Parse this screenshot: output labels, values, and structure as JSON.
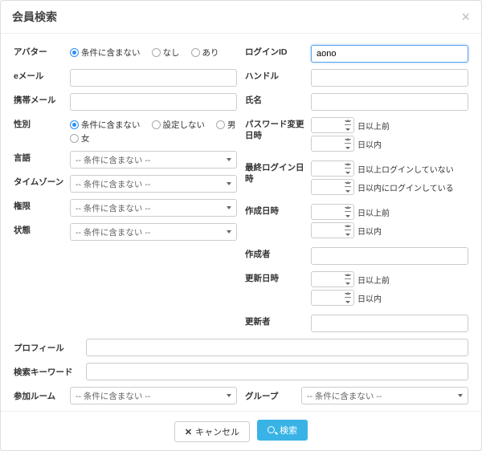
{
  "modal": {
    "title": "会員検索"
  },
  "left": {
    "avatar": {
      "label": "アバター",
      "opt1": "条件に含まない",
      "opt2": "なし",
      "opt3": "あり"
    },
    "email": {
      "label": "eメール"
    },
    "mobile": {
      "label": "携帯メール"
    },
    "gender": {
      "label": "性別",
      "opt1": "条件に含まない",
      "opt2": "設定しない",
      "opt3": "男",
      "opt4": "女"
    },
    "language": {
      "label": "言語",
      "placeholder": "-- 条件に含まない --"
    },
    "timezone": {
      "label": "タイムゾーン",
      "placeholder": "-- 条件に含まない --"
    },
    "role": {
      "label": "権限",
      "placeholder": "-- 条件に含まない --"
    },
    "status": {
      "label": "状態",
      "placeholder": "-- 条件に含まない --"
    }
  },
  "right": {
    "loginId": {
      "label": "ログインID",
      "value": "aono"
    },
    "handle": {
      "label": "ハンドル"
    },
    "name": {
      "label": "氏名"
    },
    "pwChange": {
      "label": "パスワード変更日時",
      "suf1": "日以上前",
      "suf2": "日以内"
    },
    "lastLogin": {
      "label": "最終ログイン日時",
      "suf1": "日以上ログインしていない",
      "suf2": "日以内にログインしている"
    },
    "created": {
      "label": "作成日時",
      "suf1": "日以上前",
      "suf2": "日以内"
    },
    "creator": {
      "label": "作成者"
    },
    "updated": {
      "label": "更新日時",
      "suf1": "日以上前",
      "suf2": "日以内"
    },
    "updater": {
      "label": "更新者"
    }
  },
  "full": {
    "profile": {
      "label": "プロフィール"
    },
    "keyword": {
      "label": "検索キーワード"
    },
    "room": {
      "label": "参加ルーム",
      "placeholder": "-- 条件に含まない --"
    },
    "group": {
      "label": "グループ",
      "placeholder": "-- 条件に含まない --"
    }
  },
  "footer": {
    "cancel": "キャンセル",
    "search": "検索"
  }
}
